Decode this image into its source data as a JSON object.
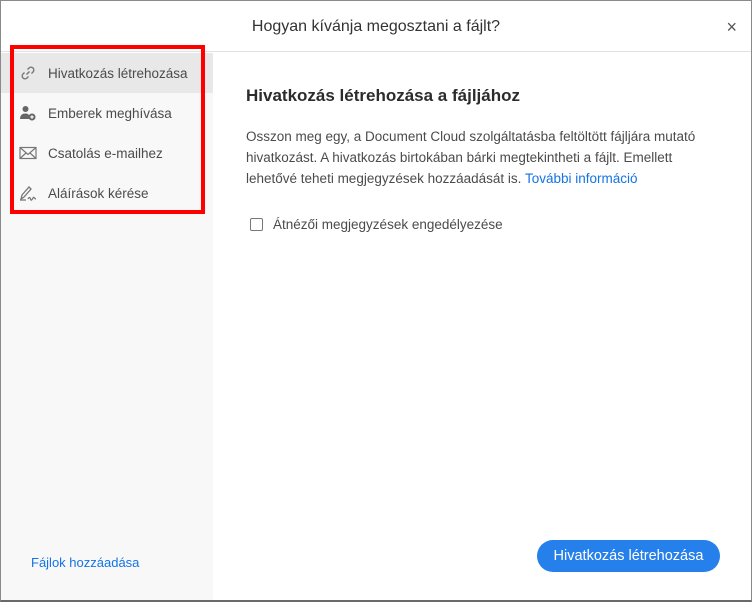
{
  "dialog": {
    "title": "Hogyan kívánja megosztani a fájlt?",
    "close": "×"
  },
  "sidebar": {
    "items": [
      {
        "label": "Hivatkozás létrehozása",
        "icon": "link-icon",
        "selected": true
      },
      {
        "label": "Emberek meghívása",
        "icon": "add-person-icon"
      },
      {
        "label": "Csatolás e-mailhez",
        "icon": "envelope-icon"
      },
      {
        "label": "Aláírások kérése",
        "icon": "signature-icon"
      }
    ],
    "add_files": "Fájlok hozzáadása"
  },
  "main": {
    "heading": "Hivatkozás létrehozása a fájljához",
    "description": "Osszon meg egy, a Document Cloud szolgáltatásba feltöltött fájljára mutató hivatkozást. A hivatkozás birtokában bárki megtekintheti a fájlt. Emellett lehetővé teheti megjegyzések hozzáadását is.",
    "more_info": "További információ",
    "checkbox_label": "Átnézői megjegyzések engedélyezése",
    "checkbox_checked": false,
    "primary_button": "Hivatkozás létrehozása"
  },
  "colors": {
    "accent": "#2680eb",
    "highlight": "#ff0000"
  }
}
